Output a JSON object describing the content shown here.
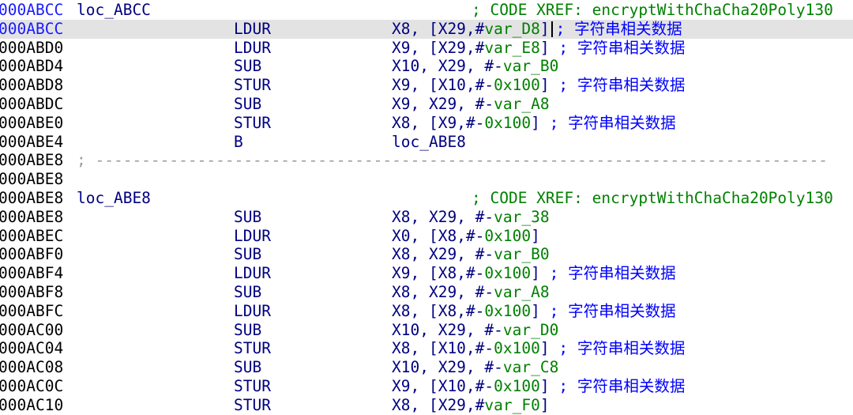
{
  "colors": {
    "register": "#000080",
    "variable": "#008000",
    "comment": "#0000ff",
    "highlight": "#e3e3e3",
    "separator": "#9a9a9a"
  },
  "comment_text": "; 字符串相关数据",
  "rows": [
    {
      "addr": "000ABCC",
      "addr_blue": true,
      "label": "loc_ABCC",
      "xref": "; CODE XREF: encryptWithChaCha20Poly130"
    },
    {
      "addr": "000ABCC",
      "addr_blue": true,
      "highlight": true,
      "cursor": true,
      "mn": "LDUR",
      "op": [
        [
          "X8, [X29,#",
          ""
        ],
        [
          "var_D8",
          "g"
        ],
        [
          "]",
          ""
        ]
      ],
      "comment": true
    },
    {
      "addr": "000ABD0",
      "mn": "LDUR",
      "op": [
        [
          "X9, [X29,#",
          ""
        ],
        [
          "var_E8",
          "g"
        ],
        [
          "]",
          ""
        ]
      ],
      "comment": true
    },
    {
      "addr": "000ABD4",
      "mn": "SUB",
      "op": [
        [
          "X10, X29, #-",
          ""
        ],
        [
          "var_B0",
          "g"
        ]
      ]
    },
    {
      "addr": "000ABD8",
      "mn": "STUR",
      "op": [
        [
          "X9, [X10,#-",
          ""
        ],
        [
          "0x100",
          "g"
        ],
        [
          "]",
          ""
        ]
      ],
      "comment": true
    },
    {
      "addr": "000ABDC",
      "mn": "SUB",
      "op": [
        [
          "X9, X29, #-",
          ""
        ],
        [
          "var_A8",
          "g"
        ]
      ]
    },
    {
      "addr": "000ABE0",
      "mn": "STUR",
      "op": [
        [
          "X8, [X9,#-",
          ""
        ],
        [
          "0x100",
          "g"
        ],
        [
          "]",
          ""
        ]
      ],
      "comment": true
    },
    {
      "addr": "000ABE4",
      "mn": "B",
      "op": [
        [
          "loc_ABE8",
          ""
        ]
      ]
    },
    {
      "addr": "000ABE8",
      "sep": "; -------------------------------------------------------------------------------"
    },
    {
      "addr": "000ABE8"
    },
    {
      "addr": "000ABE8",
      "label": "loc_ABE8",
      "xref": "; CODE XREF: encryptWithChaCha20Poly130"
    },
    {
      "addr": "000ABE8",
      "mn": "SUB",
      "op": [
        [
          "X8, X29, #-",
          ""
        ],
        [
          "var_38",
          "g"
        ]
      ]
    },
    {
      "addr": "000ABEC",
      "mn": "LDUR",
      "op": [
        [
          "X0, [X8,#-",
          ""
        ],
        [
          "0x100",
          "g"
        ],
        [
          "]",
          ""
        ]
      ]
    },
    {
      "addr": "000ABF0",
      "mn": "SUB",
      "op": [
        [
          "X8, X29, #-",
          ""
        ],
        [
          "var_B0",
          "g"
        ]
      ]
    },
    {
      "addr": "000ABF4",
      "mn": "LDUR",
      "op": [
        [
          "X9, [X8,#-",
          ""
        ],
        [
          "0x100",
          "g"
        ],
        [
          "]",
          ""
        ]
      ],
      "comment": true
    },
    {
      "addr": "000ABF8",
      "mn": "SUB",
      "op": [
        [
          "X8, X29, #-",
          ""
        ],
        [
          "var_A8",
          "g"
        ]
      ]
    },
    {
      "addr": "000ABFC",
      "mn": "LDUR",
      "op": [
        [
          "X8, [X8,#-",
          ""
        ],
        [
          "0x100",
          "g"
        ],
        [
          "]",
          ""
        ]
      ],
      "comment": true
    },
    {
      "addr": "000AC00",
      "mn": "SUB",
      "op": [
        [
          "X10, X29, #-",
          ""
        ],
        [
          "var_D0",
          "g"
        ]
      ]
    },
    {
      "addr": "000AC04",
      "mn": "STUR",
      "op": [
        [
          "X8, [X10,#-",
          ""
        ],
        [
          "0x100",
          "g"
        ],
        [
          "]",
          ""
        ]
      ],
      "comment": true
    },
    {
      "addr": "000AC08",
      "mn": "SUB",
      "op": [
        [
          "X10, X29, #-",
          ""
        ],
        [
          "var_C8",
          "g"
        ]
      ]
    },
    {
      "addr": "000AC0C",
      "mn": "STUR",
      "op": [
        [
          "X9, [X10,#-",
          ""
        ],
        [
          "0x100",
          "g"
        ],
        [
          "]",
          ""
        ]
      ],
      "comment": true
    },
    {
      "addr": "000AC10",
      "mn": "STUR",
      "op": [
        [
          "X8, [X29,#",
          ""
        ],
        [
          "var_F0",
          "g"
        ],
        [
          "]",
          ""
        ]
      ]
    }
  ]
}
